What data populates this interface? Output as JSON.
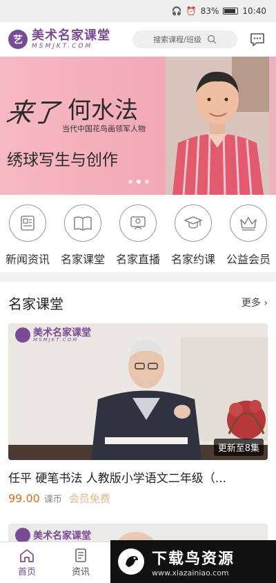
{
  "status_bar": {
    "battery": "83%",
    "time": "10:40"
  },
  "header": {
    "logo_cn": "美术名家课堂",
    "logo_en": "MSMJKT.COM",
    "search_placeholder": "搜索课程/班级"
  },
  "banner": {
    "come": "来了",
    "name": "何水法",
    "subtitle": "当代中国花鸟画领军人物",
    "topic": "绣球写生与创作",
    "slide_count": 3,
    "active_slide": 2
  },
  "quick_nav": [
    {
      "label": "新闻资讯",
      "icon": "news-icon"
    },
    {
      "label": "名家课堂",
      "icon": "book-icon"
    },
    {
      "label": "名家直播",
      "icon": "live-icon"
    },
    {
      "label": "名家约课",
      "icon": "graduation-cap-icon"
    },
    {
      "label": "公益会员",
      "icon": "crown-icon"
    }
  ],
  "section": {
    "title": "名家课堂",
    "more": "更多"
  },
  "course": {
    "logo_cn": "美术名家课堂",
    "logo_en": "MSMJKT.COM",
    "badge": "更新至8集",
    "title": "任平 硬笔书法 人教版小学语文二年级（...",
    "price": "99.00",
    "unit": "课币",
    "member": "会员免费"
  },
  "tabs": [
    {
      "label": "首页",
      "icon": "home-icon",
      "active": true
    },
    {
      "label": "资讯",
      "icon": "news-tab-icon",
      "active": false
    }
  ],
  "watermark": {
    "cn": "下载鸟资源",
    "url": "www.xiazainiao.com"
  },
  "colors": {
    "brand": "#7a4a94",
    "price": "#d4701c",
    "member": "#e3b98b",
    "banner_bg": "#f4b0bd"
  }
}
